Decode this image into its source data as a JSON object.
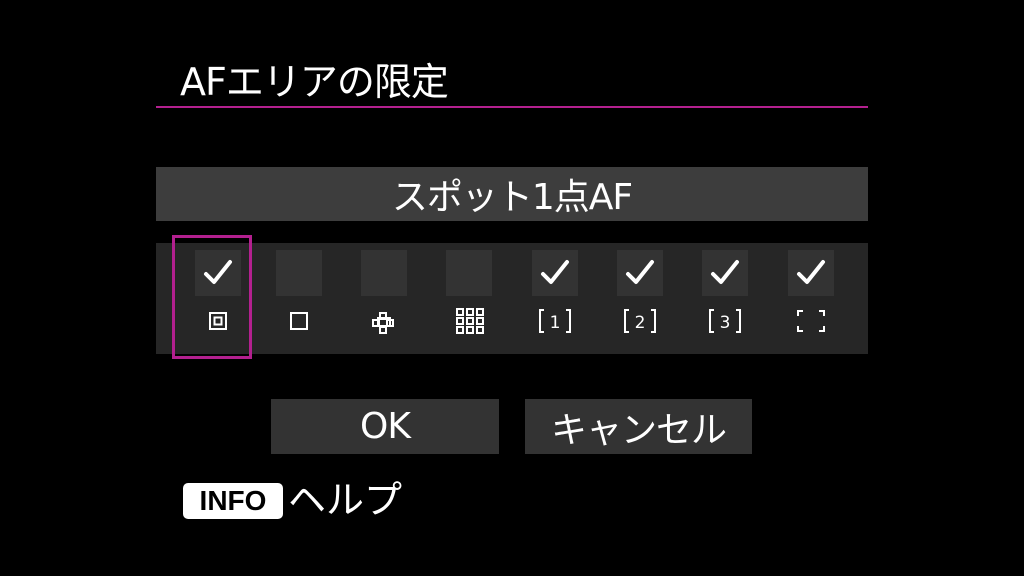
{
  "header": {
    "title": "AFエリアの限定"
  },
  "current_mode": {
    "label": "スポット1点AF"
  },
  "modes": [
    {
      "name": "spot-af",
      "checked": true,
      "icon": "spot-af-icon"
    },
    {
      "name": "single-point-af",
      "checked": false,
      "icon": "single-point-af-icon"
    },
    {
      "name": "expand-cross-af",
      "checked": false,
      "icon": "expand-cross-af-icon"
    },
    {
      "name": "expand-around-af",
      "checked": false,
      "icon": "expand-around-af-icon"
    },
    {
      "name": "flexible-zone-1",
      "checked": true,
      "icon": "zone-1-icon",
      "icon_label": "1"
    },
    {
      "name": "flexible-zone-2",
      "checked": true,
      "icon": "zone-2-icon",
      "icon_label": "2"
    },
    {
      "name": "flexible-zone-3",
      "checked": true,
      "icon": "zone-3-icon",
      "icon_label": "3"
    },
    {
      "name": "whole-area-af",
      "checked": true,
      "icon": "whole-area-icon"
    }
  ],
  "buttons": {
    "ok": "OK",
    "cancel": "キャンセル"
  },
  "footer": {
    "info_badge": "INFO",
    "help_label": "ヘルプ"
  },
  "colors": {
    "accent": "#b3208f",
    "panel": "#3d3d3d",
    "grid_bg": "#262626",
    "checkbox_bg": "#333333"
  }
}
